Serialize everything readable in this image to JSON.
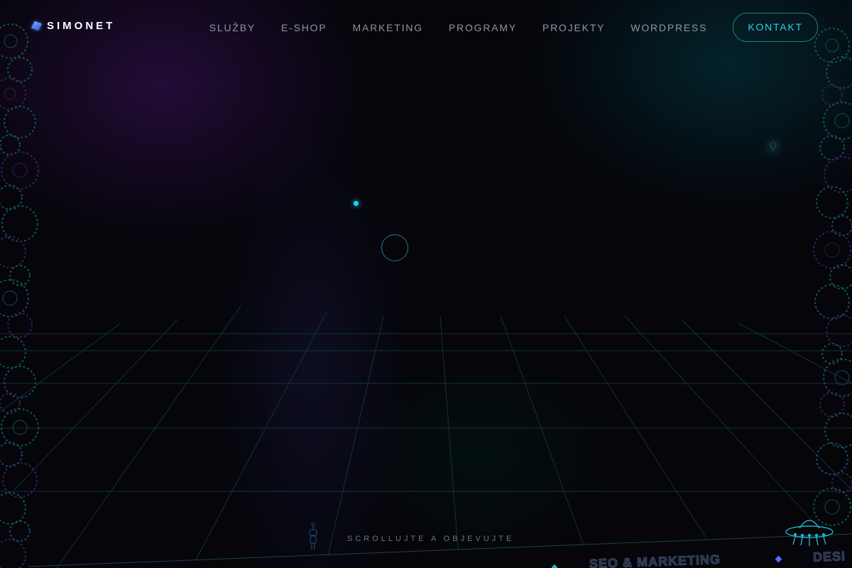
{
  "brand": {
    "name": "SIMONET"
  },
  "nav": {
    "items": [
      {
        "label": "SLUŽBY"
      },
      {
        "label": "E-SHOP"
      },
      {
        "label": "MARKETING"
      },
      {
        "label": "PROGRAMY"
      },
      {
        "label": "PROJEKTY"
      },
      {
        "label": "WORDPRESS"
      }
    ],
    "cta": "KONTAKT"
  },
  "hero": {
    "scroll_hint": "SCROLLUJTE A OBJEVUJTE"
  },
  "ticker": {
    "items": [
      "SEO & MARKETING",
      "DESI"
    ]
  },
  "icons": {
    "logo": "cube-logo-icon",
    "gears": "gear-icon",
    "robot": "robot-figure-icon",
    "ufo": "ufo-icon",
    "pin": "location-pin-icon"
  },
  "colors": {
    "accent": "#22d3ee",
    "background": "#05050a",
    "purple_glow": "#46146e",
    "teal_glow": "#004650",
    "grid": "#0f3a3f"
  }
}
